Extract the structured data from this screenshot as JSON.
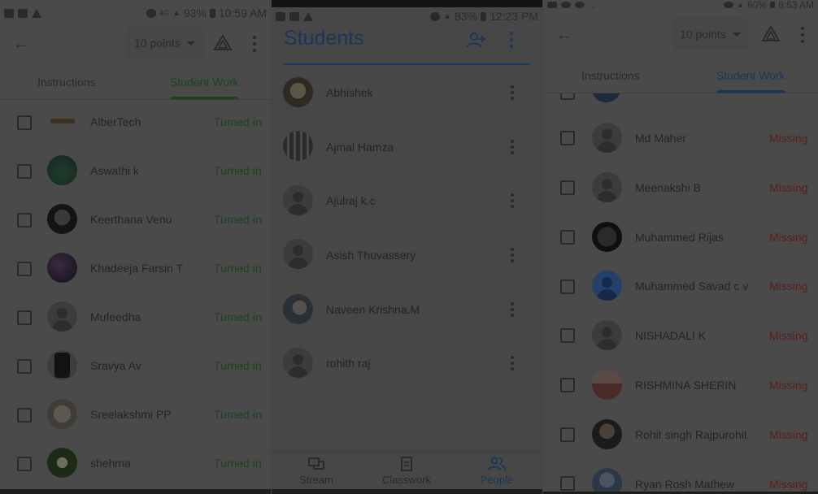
{
  "panel1": {
    "statusbar": {
      "icons": [
        "notification-icon",
        "image-icon",
        "alert-icon"
      ],
      "network": "4G",
      "battery": "93%",
      "time": "10:59 AM"
    },
    "points_label": "10 points",
    "tabs": [
      {
        "label": "Instructions"
      },
      {
        "label": "Student Work"
      }
    ],
    "students": [
      {
        "name": "AlberTech",
        "status": "Turned in"
      },
      {
        "name": "Aswathi k",
        "status": "Turned in"
      },
      {
        "name": "Keerthana Venu",
        "status": "Turned in"
      },
      {
        "name": "Khadeeja Farsin T",
        "status": "Turned in"
      },
      {
        "name": "Mufeedha",
        "status": "Turned in"
      },
      {
        "name": "Sravya Av",
        "status": "Turned in"
      },
      {
        "name": "Sreelakshmi PP",
        "status": "Turned in"
      },
      {
        "name": "shehma",
        "status": "Turned in"
      }
    ]
  },
  "panel2": {
    "statusbar": {
      "battery": "83%",
      "time": "12:23 PM"
    },
    "title": "Students",
    "students": [
      {
        "name": "Abhishek"
      },
      {
        "name": "Ajmal Hamza"
      },
      {
        "name": "Ajulraj k.c"
      },
      {
        "name": "Asish Thuvassery"
      },
      {
        "name": "Naveen Krishna.M"
      },
      {
        "name": "rohith raj"
      }
    ],
    "nav": [
      {
        "label": "Stream",
        "icon": "stream-icon"
      },
      {
        "label": "Classwork",
        "icon": "classwork-icon"
      },
      {
        "label": "People",
        "icon": "people-icon"
      }
    ]
  },
  "panel3": {
    "statusbar": {
      "left_text": "...",
      "battery": "60%",
      "time": "8:53 AM"
    },
    "points_label": "10 points",
    "tabs": [
      {
        "label": "Instructions"
      },
      {
        "label": "Student Work"
      }
    ],
    "students": [
      {
        "name": "Md Maher",
        "status": "Missing"
      },
      {
        "name": "Meenakshi B",
        "status": "Missing"
      },
      {
        "name": "Muhammed Rijas",
        "status": "Missing"
      },
      {
        "name": "Muhammed Savad c v",
        "status": "Missing"
      },
      {
        "name": "NISHADALI K",
        "status": "Missing"
      },
      {
        "name": "RISHMINA SHERIN",
        "status": "Missing"
      },
      {
        "name": "Rohit singh Rajpurohit",
        "status": "Missing"
      },
      {
        "name": "Ryan Rosh Mathew",
        "status": "Missing"
      }
    ]
  },
  "colors": {
    "turned_in": "#1c421f",
    "missing": "#5c1c1c",
    "active_tab_green": "#1c421f",
    "active_tab_blue": "#1b355c"
  }
}
